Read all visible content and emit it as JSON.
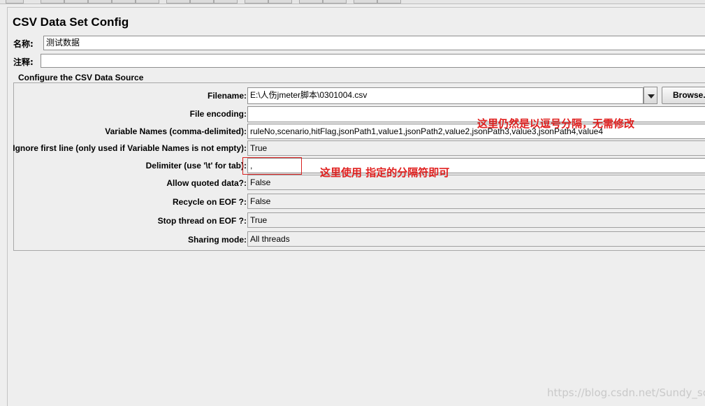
{
  "title": "CSV Data Set Config",
  "name_field": {
    "label": "名称:",
    "value": "测试数据"
  },
  "comment_field": {
    "label": "注释:",
    "value": ""
  },
  "group": {
    "legend": "Configure the CSV Data Source",
    "filename": {
      "label": "Filename:",
      "value": "E:\\人伤jmeter脚本\\0301004.csv",
      "browse_label": "Browse..."
    },
    "file_encoding": {
      "label": "File encoding:",
      "value": ""
    },
    "variable_names": {
      "label": "Variable Names (comma-delimited):",
      "value": "ruleNo,scenario,hitFlag,jsonPath1,value1,jsonPath2,value2,jsonPath3,value3,jsonPath4,value4"
    },
    "ignore_first_line": {
      "label": "Ignore first line (only used if Variable Names is not empty):",
      "value": "True"
    },
    "delimiter": {
      "label": "Delimiter (use '\\t' for tab):",
      "value": ","
    },
    "allow_quoted": {
      "label": "Allow quoted data?:",
      "value": "False"
    },
    "recycle_eof": {
      "label": "Recycle on EOF ?:",
      "value": "False"
    },
    "stop_thread_eof": {
      "label": "Stop thread on EOF ?:",
      "value": "True"
    },
    "sharing_mode": {
      "label": "Sharing mode:",
      "value": "All threads"
    }
  },
  "annotations": {
    "comma_note": "这里仍然是以逗号分隔，无需修改",
    "delimiter_note": "这里使用 指定的分隔符即可"
  },
  "watermark": "https://blog.csdn.net/Sundy_sc",
  "colors": {
    "annotation": "#e0201f",
    "background": "#eeeeee"
  }
}
